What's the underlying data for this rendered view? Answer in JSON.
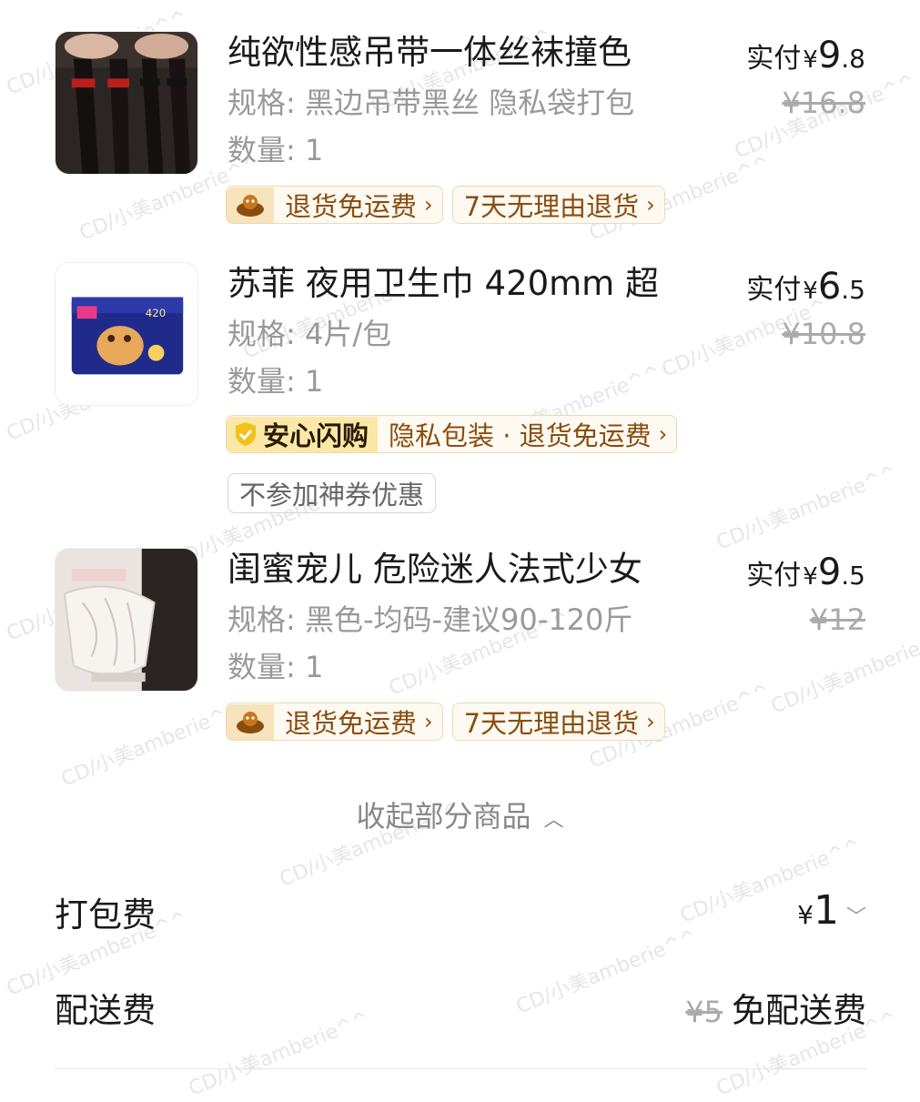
{
  "items": [
    {
      "name": "纯欲性感吊带一体丝袜撞色",
      "spec": "规格: 黑边吊带黑丝 隐私袋打包",
      "qty": "数量: 1",
      "paid_label": "实付",
      "paid_yen": "¥",
      "paid_int": "9",
      "paid_dec": ".8",
      "orig_price": "¥16.8",
      "tags": [
        "退货免运费",
        "7天无理由退货"
      ],
      "thumb_icon": "stockings-photo"
    },
    {
      "name": "苏菲 夜用卫生巾 420mm 超",
      "spec": "规格: 4片/包",
      "qty": "数量: 1",
      "paid_label": "实付",
      "paid_yen": "¥",
      "paid_int": "6",
      "paid_dec": ".5",
      "orig_price": "¥10.8",
      "anxin_head": "安心闪购",
      "anxin_text": "隐私包装 · 退货免运费",
      "extra_tag": "不参加神券优惠",
      "thumb_text": "420",
      "thumb_icon": "pad-package-photo"
    },
    {
      "name": "闺蜜宠儿 危险迷人法式少女",
      "spec": "规格: 黑色-均码-建议90-120斤",
      "qty": "数量: 1",
      "paid_label": "实付",
      "paid_yen": "¥",
      "paid_int": "9",
      "paid_dec": ".5",
      "orig_price": "¥12",
      "tags": [
        "退货免运费",
        "7天无理由退货"
      ],
      "thumb_icon": "lace-lingerie-photo"
    }
  ],
  "collapse_label": "收起部分商品",
  "fees": {
    "packing_label": "打包费",
    "packing_yen": "¥",
    "packing_value": "1",
    "delivery_label": "配送费",
    "delivery_orig": "¥5",
    "delivery_value": "免配送费"
  },
  "watermark": "CD/小美amberie^^",
  "colors": {
    "tag_border": "#ecd9b6",
    "tag_text": "#8a4d10",
    "muted_text": "#999999",
    "anxin_bg": "#fbe8a6"
  }
}
